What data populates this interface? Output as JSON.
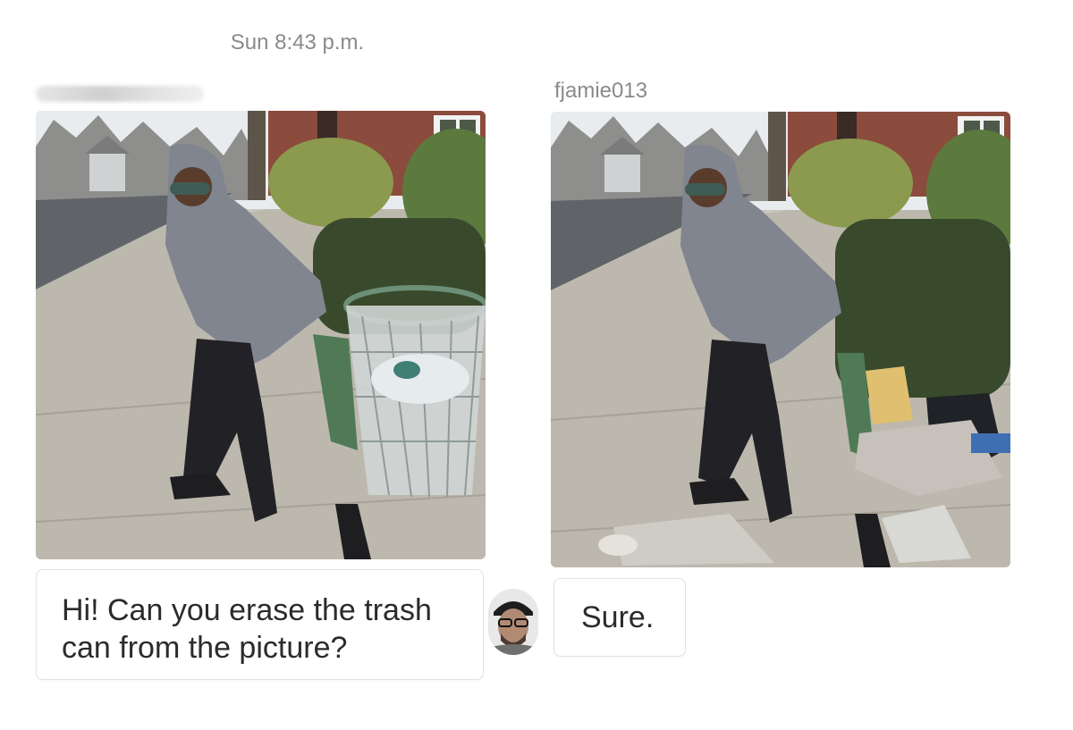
{
  "conversation": {
    "timestamp": "Sun 8:43 p.m.",
    "reply_username": "fjamie013",
    "messages": [
      {
        "from": "sender",
        "text": "Hi! Can you erase the trash can from the picture?"
      },
      {
        "from": "fjamie013",
        "text": "Sure."
      }
    ],
    "photos": [
      {
        "from": "sender",
        "subject": "person posing on sidewalk next to a wire trash can"
      },
      {
        "from": "fjamie013",
        "subject": "same photo with trash can removed, trash spilled on the ground"
      }
    ]
  },
  "icons": {
    "avatar": "avatar-icon"
  },
  "colors": {
    "text_muted": "#8a8a8a",
    "bubble_border": "#e2e2e2",
    "text": "#2b2b2b"
  }
}
